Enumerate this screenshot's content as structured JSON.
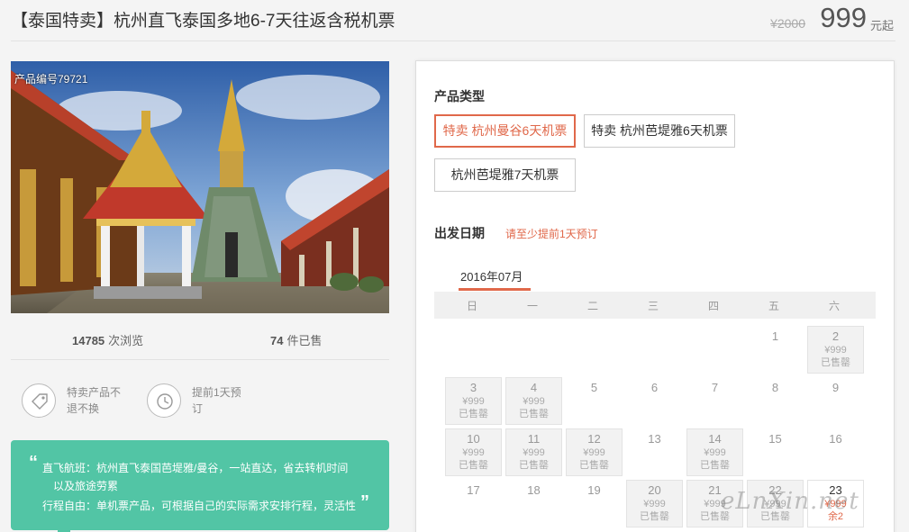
{
  "header": {
    "title": "【泰国特卖】杭州直飞泰国多地6-7天往返含税机票",
    "price_original": "¥2000",
    "price": "999",
    "price_unit": "元起"
  },
  "photo": {
    "product_no": "产品编号79721"
  },
  "stats": {
    "views_count": "14785",
    "views_label": "次浏览",
    "sold_count": "74",
    "sold_label": "件已售"
  },
  "features": [
    {
      "icon": "tag-icon",
      "line1": "特卖产品不",
      "line2": "退不换"
    },
    {
      "icon": "clock-icon",
      "line1": "提前1天预",
      "line2": "订"
    }
  ],
  "highlights": {
    "line1": "直飞航班：杭州直飞泰国芭堤雅/曼谷，一站直达，省去转机时间",
    "line2": "以及旅途劳累",
    "line3": "行程自由：单机票产品，可根据自己的实际需求安排行程，灵活性"
  },
  "booking": {
    "product_type_label": "产品类型",
    "options": [
      {
        "label": "特卖 杭州曼谷6天机票",
        "selected": true
      },
      {
        "label": "特卖 杭州芭堤雅6天机票",
        "selected": false
      },
      {
        "label": "杭州芭堤雅7天机票",
        "selected": false
      }
    ],
    "date_label": "出发日期",
    "date_note": "请至少提前1天预订",
    "month": "2016年07月",
    "weekdays": [
      "日",
      "一",
      "二",
      "三",
      "四",
      "五",
      "六"
    ],
    "sold_out_text": "已售罄",
    "days": [
      {
        "day": "1",
        "col": 5,
        "row": 0,
        "status": "plain"
      },
      {
        "day": "2",
        "col": 6,
        "row": 0,
        "status": "sold",
        "price": "¥999"
      },
      {
        "day": "3",
        "col": 0,
        "row": 1,
        "status": "sold",
        "price": "¥999"
      },
      {
        "day": "4",
        "col": 1,
        "row": 1,
        "status": "sold",
        "price": "¥999"
      },
      {
        "day": "5",
        "col": 2,
        "row": 1,
        "status": "plain"
      },
      {
        "day": "6",
        "col": 3,
        "row": 1,
        "status": "plain"
      },
      {
        "day": "7",
        "col": 4,
        "row": 1,
        "status": "plain"
      },
      {
        "day": "8",
        "col": 5,
        "row": 1,
        "status": "plain"
      },
      {
        "day": "9",
        "col": 6,
        "row": 1,
        "status": "plain"
      },
      {
        "day": "10",
        "col": 0,
        "row": 2,
        "status": "sold",
        "price": "¥999"
      },
      {
        "day": "11",
        "col": 1,
        "row": 2,
        "status": "sold",
        "price": "¥999"
      },
      {
        "day": "12",
        "col": 2,
        "row": 2,
        "status": "sold",
        "price": "¥999"
      },
      {
        "day": "13",
        "col": 3,
        "row": 2,
        "status": "plain"
      },
      {
        "day": "14",
        "col": 4,
        "row": 2,
        "status": "sold",
        "price": "¥999"
      },
      {
        "day": "15",
        "col": 5,
        "row": 2,
        "status": "plain"
      },
      {
        "day": "16",
        "col": 6,
        "row": 2,
        "status": "plain"
      },
      {
        "day": "17",
        "col": 0,
        "row": 3,
        "status": "plain"
      },
      {
        "day": "18",
        "col": 1,
        "row": 3,
        "status": "plain"
      },
      {
        "day": "19",
        "col": 2,
        "row": 3,
        "status": "plain"
      },
      {
        "day": "20",
        "col": 3,
        "row": 3,
        "status": "sold",
        "price": "¥999"
      },
      {
        "day": "21",
        "col": 4,
        "row": 3,
        "status": "sold",
        "price": "¥999"
      },
      {
        "day": "22",
        "col": 5,
        "row": 3,
        "status": "sold",
        "price": "¥999"
      },
      {
        "day": "23",
        "col": 6,
        "row": 3,
        "status": "avail",
        "price": "¥999",
        "stock": "余2"
      }
    ]
  },
  "watermark": "eLnXin.net",
  "colors": {
    "accent": "#e0684a",
    "green": "#52c5a5"
  }
}
